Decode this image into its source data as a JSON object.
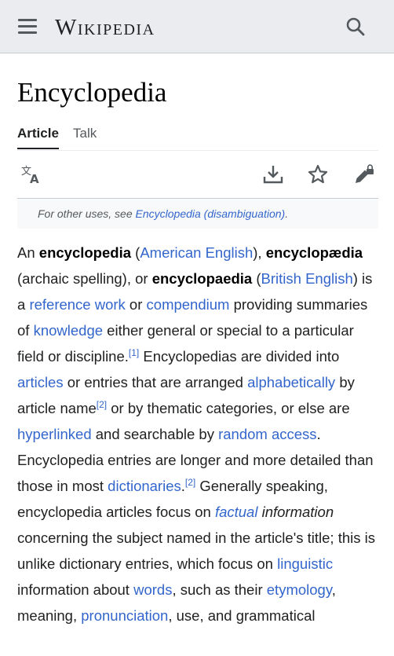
{
  "header": {
    "logo_text": "Wikipedia",
    "menu_icon": "hamburger-menu-icon",
    "search_icon": "search-icon"
  },
  "page": {
    "title": "Encyclopedia",
    "tabs": [
      {
        "label": "Article",
        "active": true
      },
      {
        "label": "Talk",
        "active": false
      }
    ]
  },
  "actions": {
    "language_icon": "language-icon",
    "download_icon": "download-icon",
    "watch_icon": "star-icon",
    "edit_icon": "edit-lock-icon"
  },
  "hatnote": {
    "prefix": "For other uses, see ",
    "link": "Encyclopedia (disambiguation)",
    "suffix": "."
  },
  "article": {
    "t1": "An ",
    "b1": "encyclopedia",
    "t2": " (",
    "l_american": "American English",
    "t3": "), ",
    "b2": "encyclopædia",
    "t4": " (archaic spelling), or ",
    "b3": "encyclopaedia",
    "t5": " (",
    "l_british": "British English",
    "t6": ") is a ",
    "l_reference": "reference work",
    "t7": " or ",
    "l_compendium": "compendium",
    "t8": " providing summaries of ",
    "l_knowledge": "knowledge",
    "t9": " either general or special to a particular field or discipline.",
    "ref1": "[1]",
    "t10": " Encyclopedias are divided into ",
    "l_articles": "articles",
    "t11": " or entries that are arranged ",
    "l_alphabetically": "alphabetically",
    "t12": " by article name",
    "ref2a": "[2]",
    "t13": " or by thematic categories, or else are ",
    "l_hyperlinked": "hyperlinked",
    "t14": " and searchable by ",
    "l_random": "random access",
    "t15": ". Encyclopedia entries are longer and more detailed than those in most ",
    "l_dictionaries": "dictionaries",
    "t16": ".",
    "ref2b": "[2]",
    "t17": " Generally speaking, encyclopedia articles focus on ",
    "l_factual": "factual",
    "t18": " information",
    "t19": " concerning the subject named in the article's title; this is unlike dictionary entries, which focus on ",
    "l_linguistic": "linguistic",
    "t20": " information about ",
    "l_words": "words",
    "t21": ", such as their ",
    "l_etymology": "etymology",
    "t22": ", meaning, ",
    "l_pronunciation": "pronunciation",
    "t23": ", use, and grammatical"
  },
  "colors": {
    "link": "#3366cc",
    "header_bg": "#eaecf0",
    "hatnote_bg": "#f8f9fa",
    "text": "#202122"
  }
}
